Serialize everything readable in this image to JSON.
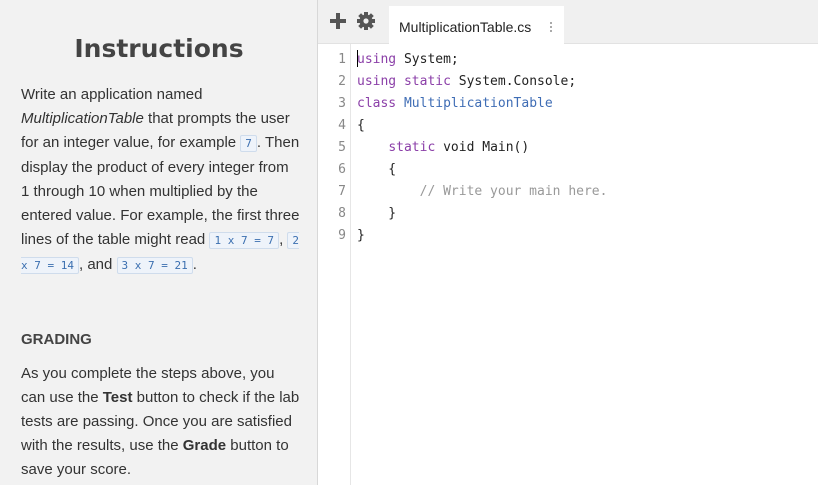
{
  "instructions": {
    "title": "Instructions",
    "p1": {
      "t1": "Write an application named ",
      "class_name": "MultiplicationTable",
      "t2": " that prompts the user for an integer value, for example ",
      "code1": "7",
      "t3": ". Then display the product of every integer from 1 through 10 when multiplied by the entered value. For example, the first three lines of the table might read ",
      "code2": "1 x 7 = 7",
      "t4": ",",
      "code3": "2 x 7 = 14",
      "t5": ", and ",
      "code4": "3 x 7 = 21",
      "t6": "."
    },
    "grading_title": "GRADING",
    "p2": {
      "t1": "As you complete the steps above, you can use the ",
      "test": "Test",
      "t2": " button to check if the lab tests are passing. Once you are satisfied with the results, use the ",
      "grade": "Grade",
      "t3": " button to save your score."
    }
  },
  "toolbar": {
    "add_icon": "plus-icon",
    "settings_icon": "gear-icon",
    "tab_label": "MultiplicationTable.cs",
    "tab_menu_icon": "vertical-dots-icon"
  },
  "editor": {
    "line_numbers": [
      "1",
      "2",
      "3",
      "4",
      "5",
      "6",
      "7",
      "8",
      "9"
    ],
    "lines": [
      {
        "kw": "using",
        "rest": " System;"
      },
      {
        "kw": "using static",
        "rest": " System.Console;"
      },
      {
        "kw": "class",
        "cls": " MultiplicationTable"
      },
      {
        "plain": "{"
      },
      {
        "indent": "    ",
        "kw": "static",
        "rest": " void Main()"
      },
      {
        "plain": "    {"
      },
      {
        "comment": "        // Write your main here."
      },
      {
        "plain": "    }"
      },
      {
        "plain": "}"
      }
    ]
  },
  "colors": {
    "keyword": "#8b3fa8",
    "class_name": "#3f6db5",
    "comment": "#999999",
    "inline_code": "#3b6fb0"
  }
}
